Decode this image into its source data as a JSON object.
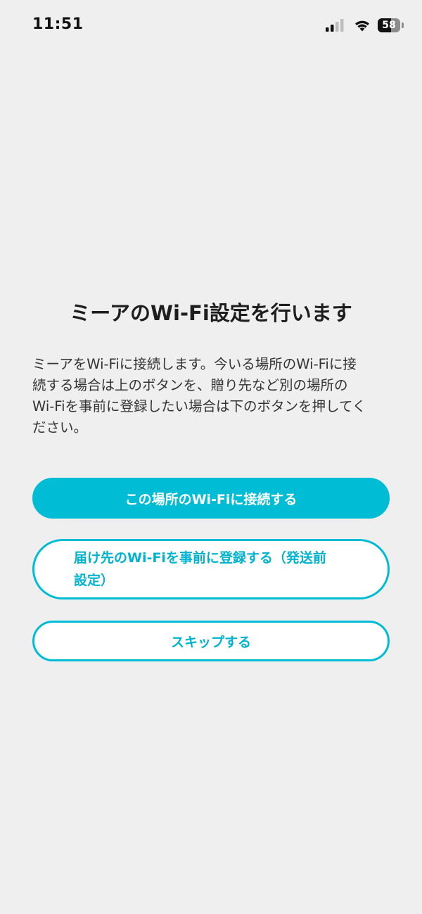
{
  "status_bar": {
    "time": "11:51",
    "battery_level": "58",
    "signal_icon": "cellular-signal-icon",
    "wifi_icon": "wifi-icon"
  },
  "main": {
    "title": "ミーアのWi-Fi設定を行います",
    "description": "ミーアをWi-Fiに接続します。今いる場所のWi-Fiに接\n続する場合は上のボタンを、贈り先など別の場所の\nWi-Fiを事前に登録したい場合は下のボタンを押してく\nださい。"
  },
  "buttons": {
    "connect_here": "この場所のWi-Fiに接続する",
    "register_destination": "届け先のWi-Fiを事前に登録する（発送前\n設定）",
    "skip": "スキップする"
  },
  "colors": {
    "accent": "#00bcd4",
    "background": "#efefef"
  }
}
